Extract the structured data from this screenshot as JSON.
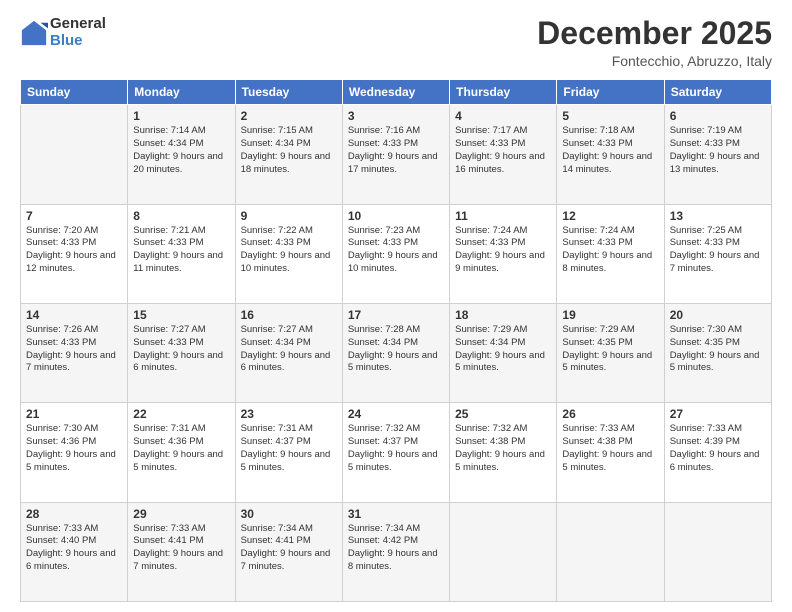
{
  "logo": {
    "general": "General",
    "blue": "Blue"
  },
  "title": "December 2025",
  "location": "Fontecchio, Abruzzo, Italy",
  "days_header": [
    "Sunday",
    "Monday",
    "Tuesday",
    "Wednesday",
    "Thursday",
    "Friday",
    "Saturday"
  ],
  "weeks": [
    [
      {
        "day": "",
        "sunrise": "",
        "sunset": "",
        "daylight": ""
      },
      {
        "day": "1",
        "sunrise": "Sunrise: 7:14 AM",
        "sunset": "Sunset: 4:34 PM",
        "daylight": "Daylight: 9 hours and 20 minutes."
      },
      {
        "day": "2",
        "sunrise": "Sunrise: 7:15 AM",
        "sunset": "Sunset: 4:34 PM",
        "daylight": "Daylight: 9 hours and 18 minutes."
      },
      {
        "day": "3",
        "sunrise": "Sunrise: 7:16 AM",
        "sunset": "Sunset: 4:33 PM",
        "daylight": "Daylight: 9 hours and 17 minutes."
      },
      {
        "day": "4",
        "sunrise": "Sunrise: 7:17 AM",
        "sunset": "Sunset: 4:33 PM",
        "daylight": "Daylight: 9 hours and 16 minutes."
      },
      {
        "day": "5",
        "sunrise": "Sunrise: 7:18 AM",
        "sunset": "Sunset: 4:33 PM",
        "daylight": "Daylight: 9 hours and 14 minutes."
      },
      {
        "day": "6",
        "sunrise": "Sunrise: 7:19 AM",
        "sunset": "Sunset: 4:33 PM",
        "daylight": "Daylight: 9 hours and 13 minutes."
      }
    ],
    [
      {
        "day": "7",
        "sunrise": "Sunrise: 7:20 AM",
        "sunset": "Sunset: 4:33 PM",
        "daylight": "Daylight: 9 hours and 12 minutes."
      },
      {
        "day": "8",
        "sunrise": "Sunrise: 7:21 AM",
        "sunset": "Sunset: 4:33 PM",
        "daylight": "Daylight: 9 hours and 11 minutes."
      },
      {
        "day": "9",
        "sunrise": "Sunrise: 7:22 AM",
        "sunset": "Sunset: 4:33 PM",
        "daylight": "Daylight: 9 hours and 10 minutes."
      },
      {
        "day": "10",
        "sunrise": "Sunrise: 7:23 AM",
        "sunset": "Sunset: 4:33 PM",
        "daylight": "Daylight: 9 hours and 10 minutes."
      },
      {
        "day": "11",
        "sunrise": "Sunrise: 7:24 AM",
        "sunset": "Sunset: 4:33 PM",
        "daylight": "Daylight: 9 hours and 9 minutes."
      },
      {
        "day": "12",
        "sunrise": "Sunrise: 7:24 AM",
        "sunset": "Sunset: 4:33 PM",
        "daylight": "Daylight: 9 hours and 8 minutes."
      },
      {
        "day": "13",
        "sunrise": "Sunrise: 7:25 AM",
        "sunset": "Sunset: 4:33 PM",
        "daylight": "Daylight: 9 hours and 7 minutes."
      }
    ],
    [
      {
        "day": "14",
        "sunrise": "Sunrise: 7:26 AM",
        "sunset": "Sunset: 4:33 PM",
        "daylight": "Daylight: 9 hours and 7 minutes."
      },
      {
        "day": "15",
        "sunrise": "Sunrise: 7:27 AM",
        "sunset": "Sunset: 4:33 PM",
        "daylight": "Daylight: 9 hours and 6 minutes."
      },
      {
        "day": "16",
        "sunrise": "Sunrise: 7:27 AM",
        "sunset": "Sunset: 4:34 PM",
        "daylight": "Daylight: 9 hours and 6 minutes."
      },
      {
        "day": "17",
        "sunrise": "Sunrise: 7:28 AM",
        "sunset": "Sunset: 4:34 PM",
        "daylight": "Daylight: 9 hours and 5 minutes."
      },
      {
        "day": "18",
        "sunrise": "Sunrise: 7:29 AM",
        "sunset": "Sunset: 4:34 PM",
        "daylight": "Daylight: 9 hours and 5 minutes."
      },
      {
        "day": "19",
        "sunrise": "Sunrise: 7:29 AM",
        "sunset": "Sunset: 4:35 PM",
        "daylight": "Daylight: 9 hours and 5 minutes."
      },
      {
        "day": "20",
        "sunrise": "Sunrise: 7:30 AM",
        "sunset": "Sunset: 4:35 PM",
        "daylight": "Daylight: 9 hours and 5 minutes."
      }
    ],
    [
      {
        "day": "21",
        "sunrise": "Sunrise: 7:30 AM",
        "sunset": "Sunset: 4:36 PM",
        "daylight": "Daylight: 9 hours and 5 minutes."
      },
      {
        "day": "22",
        "sunrise": "Sunrise: 7:31 AM",
        "sunset": "Sunset: 4:36 PM",
        "daylight": "Daylight: 9 hours and 5 minutes."
      },
      {
        "day": "23",
        "sunrise": "Sunrise: 7:31 AM",
        "sunset": "Sunset: 4:37 PM",
        "daylight": "Daylight: 9 hours and 5 minutes."
      },
      {
        "day": "24",
        "sunrise": "Sunrise: 7:32 AM",
        "sunset": "Sunset: 4:37 PM",
        "daylight": "Daylight: 9 hours and 5 minutes."
      },
      {
        "day": "25",
        "sunrise": "Sunrise: 7:32 AM",
        "sunset": "Sunset: 4:38 PM",
        "daylight": "Daylight: 9 hours and 5 minutes."
      },
      {
        "day": "26",
        "sunrise": "Sunrise: 7:33 AM",
        "sunset": "Sunset: 4:38 PM",
        "daylight": "Daylight: 9 hours and 5 minutes."
      },
      {
        "day": "27",
        "sunrise": "Sunrise: 7:33 AM",
        "sunset": "Sunset: 4:39 PM",
        "daylight": "Daylight: 9 hours and 6 minutes."
      }
    ],
    [
      {
        "day": "28",
        "sunrise": "Sunrise: 7:33 AM",
        "sunset": "Sunset: 4:40 PM",
        "daylight": "Daylight: 9 hours and 6 minutes."
      },
      {
        "day": "29",
        "sunrise": "Sunrise: 7:33 AM",
        "sunset": "Sunset: 4:41 PM",
        "daylight": "Daylight: 9 hours and 7 minutes."
      },
      {
        "day": "30",
        "sunrise": "Sunrise: 7:34 AM",
        "sunset": "Sunset: 4:41 PM",
        "daylight": "Daylight: 9 hours and 7 minutes."
      },
      {
        "day": "31",
        "sunrise": "Sunrise: 7:34 AM",
        "sunset": "Sunset: 4:42 PM",
        "daylight": "Daylight: 9 hours and 8 minutes."
      },
      {
        "day": "",
        "sunrise": "",
        "sunset": "",
        "daylight": ""
      },
      {
        "day": "",
        "sunrise": "",
        "sunset": "",
        "daylight": ""
      },
      {
        "day": "",
        "sunrise": "",
        "sunset": "",
        "daylight": ""
      }
    ]
  ]
}
